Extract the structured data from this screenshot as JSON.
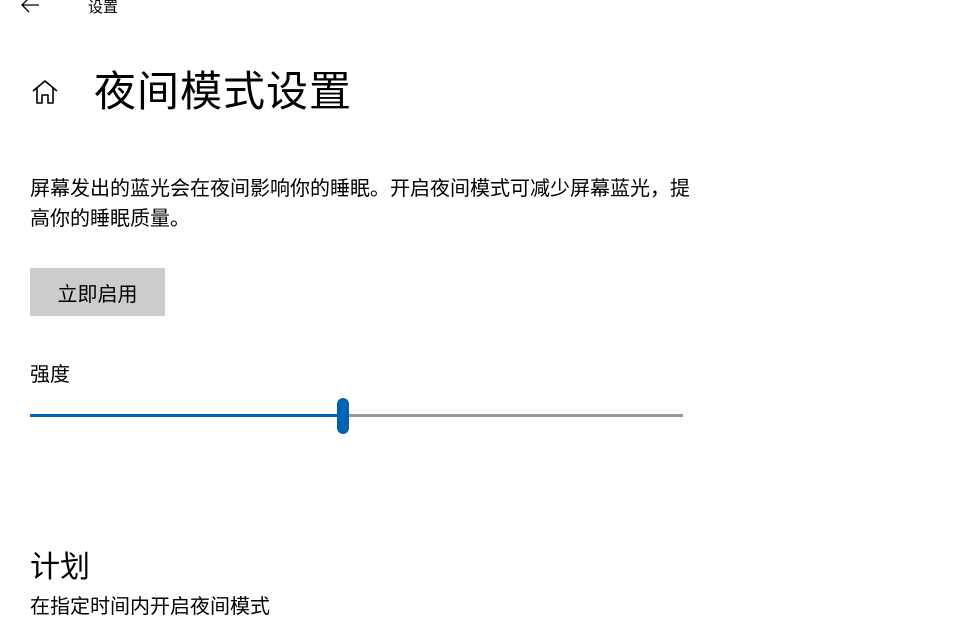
{
  "window": {
    "title": "设置",
    "back_icon": "arrow-left-icon"
  },
  "header": {
    "home_icon": "home-icon",
    "title": "夜间模式设置"
  },
  "main": {
    "description": "屏幕发出的蓝光会在夜间影响你的睡眠。开启夜间模式可减少屏幕蓝光，提高你的睡眠质量。",
    "enable_button_label": "立即启用",
    "strength": {
      "label": "强度",
      "value_fraction": 0.48,
      "accent_color": "#0063b1",
      "track_color": "#999999"
    },
    "schedule": {
      "heading": "计划",
      "toggle_label": "在指定时间内开启夜间模式"
    }
  }
}
